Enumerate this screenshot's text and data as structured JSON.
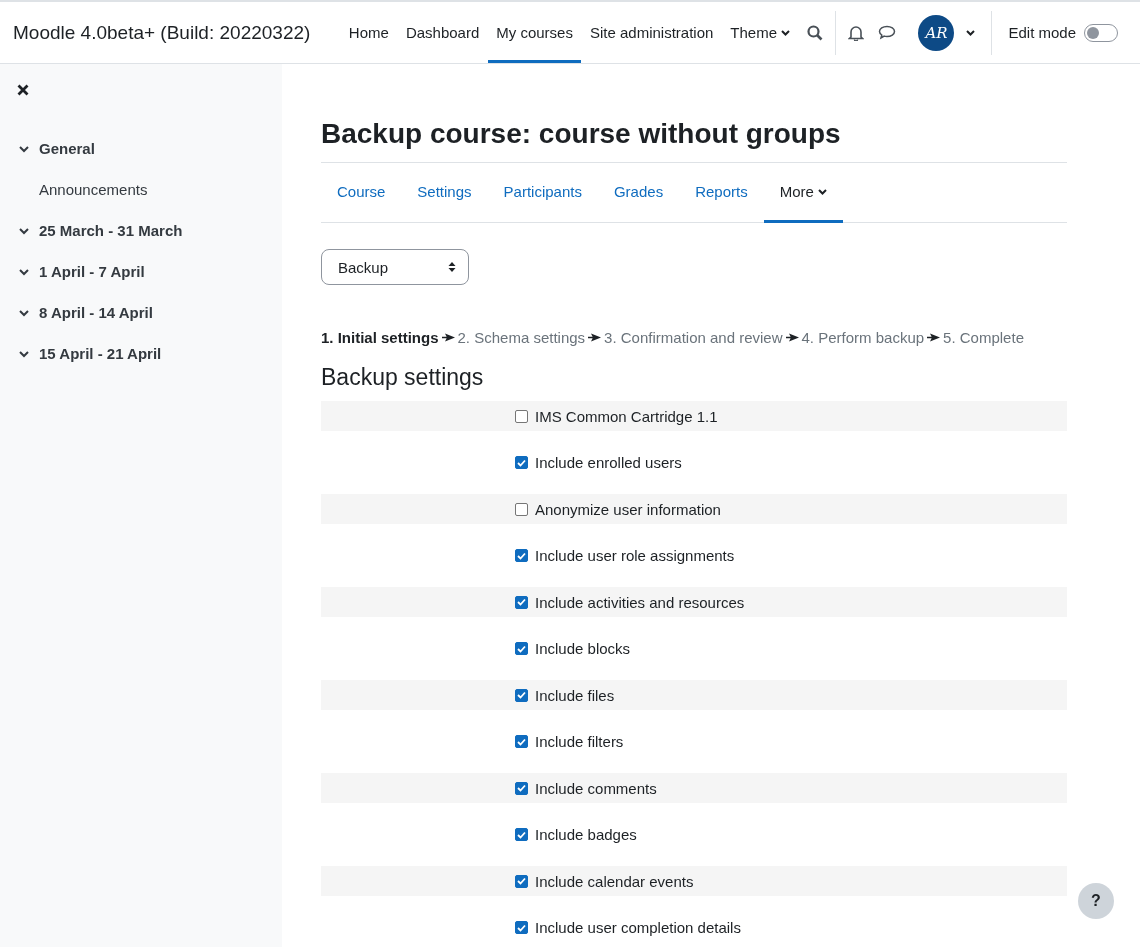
{
  "site_title": "Moodle 4.0beta+ (Build: 20220322)",
  "nav": [
    {
      "label": "Home",
      "selected": false,
      "dropdown": false
    },
    {
      "label": "Dashboard",
      "selected": false,
      "dropdown": false
    },
    {
      "label": "My courses",
      "selected": true,
      "dropdown": false
    },
    {
      "label": "Site administration",
      "selected": false,
      "dropdown": false
    },
    {
      "label": "Theme",
      "selected": false,
      "dropdown": true
    }
  ],
  "avatar": {
    "initials": "AR"
  },
  "edit_mode": {
    "label": "Edit mode",
    "on": false
  },
  "sidebar": {
    "items": [
      {
        "label": "General",
        "children": [
          {
            "label": "Announcements"
          }
        ]
      },
      {
        "label": "25 March - 31 March"
      },
      {
        "label": "1 April - 7 April"
      },
      {
        "label": "8 April - 14 April"
      },
      {
        "label": "15 April - 21 April"
      }
    ]
  },
  "page_title": "Backup course: course without groups",
  "tabs": [
    {
      "label": "Course",
      "selected": false,
      "dropdown": false
    },
    {
      "label": "Settings",
      "selected": false,
      "dropdown": false
    },
    {
      "label": "Participants",
      "selected": false,
      "dropdown": false
    },
    {
      "label": "Grades",
      "selected": false,
      "dropdown": false
    },
    {
      "label": "Reports",
      "selected": false,
      "dropdown": false
    },
    {
      "label": "More",
      "selected": true,
      "dropdown": true
    }
  ],
  "select": {
    "value": "Backup"
  },
  "steps": [
    {
      "label": "1. Initial settings",
      "selected": true
    },
    {
      "label": "2. Schema settings",
      "selected": false
    },
    {
      "label": "3. Confirmation and review",
      "selected": false
    },
    {
      "label": "4. Perform backup",
      "selected": false
    },
    {
      "label": "5. Complete",
      "selected": false
    }
  ],
  "section_title": "Backup settings",
  "settings": [
    {
      "label": "IMS Common Cartridge 1.1",
      "checked": false
    },
    {
      "label": "Include enrolled users",
      "checked": true
    },
    {
      "label": "Anonymize user information",
      "checked": false
    },
    {
      "label": "Include user role assignments",
      "checked": true
    },
    {
      "label": "Include activities and resources",
      "checked": true
    },
    {
      "label": "Include blocks",
      "checked": true
    },
    {
      "label": "Include files",
      "checked": true
    },
    {
      "label": "Include filters",
      "checked": true
    },
    {
      "label": "Include comments",
      "checked": true
    },
    {
      "label": "Include badges",
      "checked": true
    },
    {
      "label": "Include calendar events",
      "checked": true
    },
    {
      "label": "Include user completion details",
      "checked": true
    }
  ],
  "help_button": "?"
}
